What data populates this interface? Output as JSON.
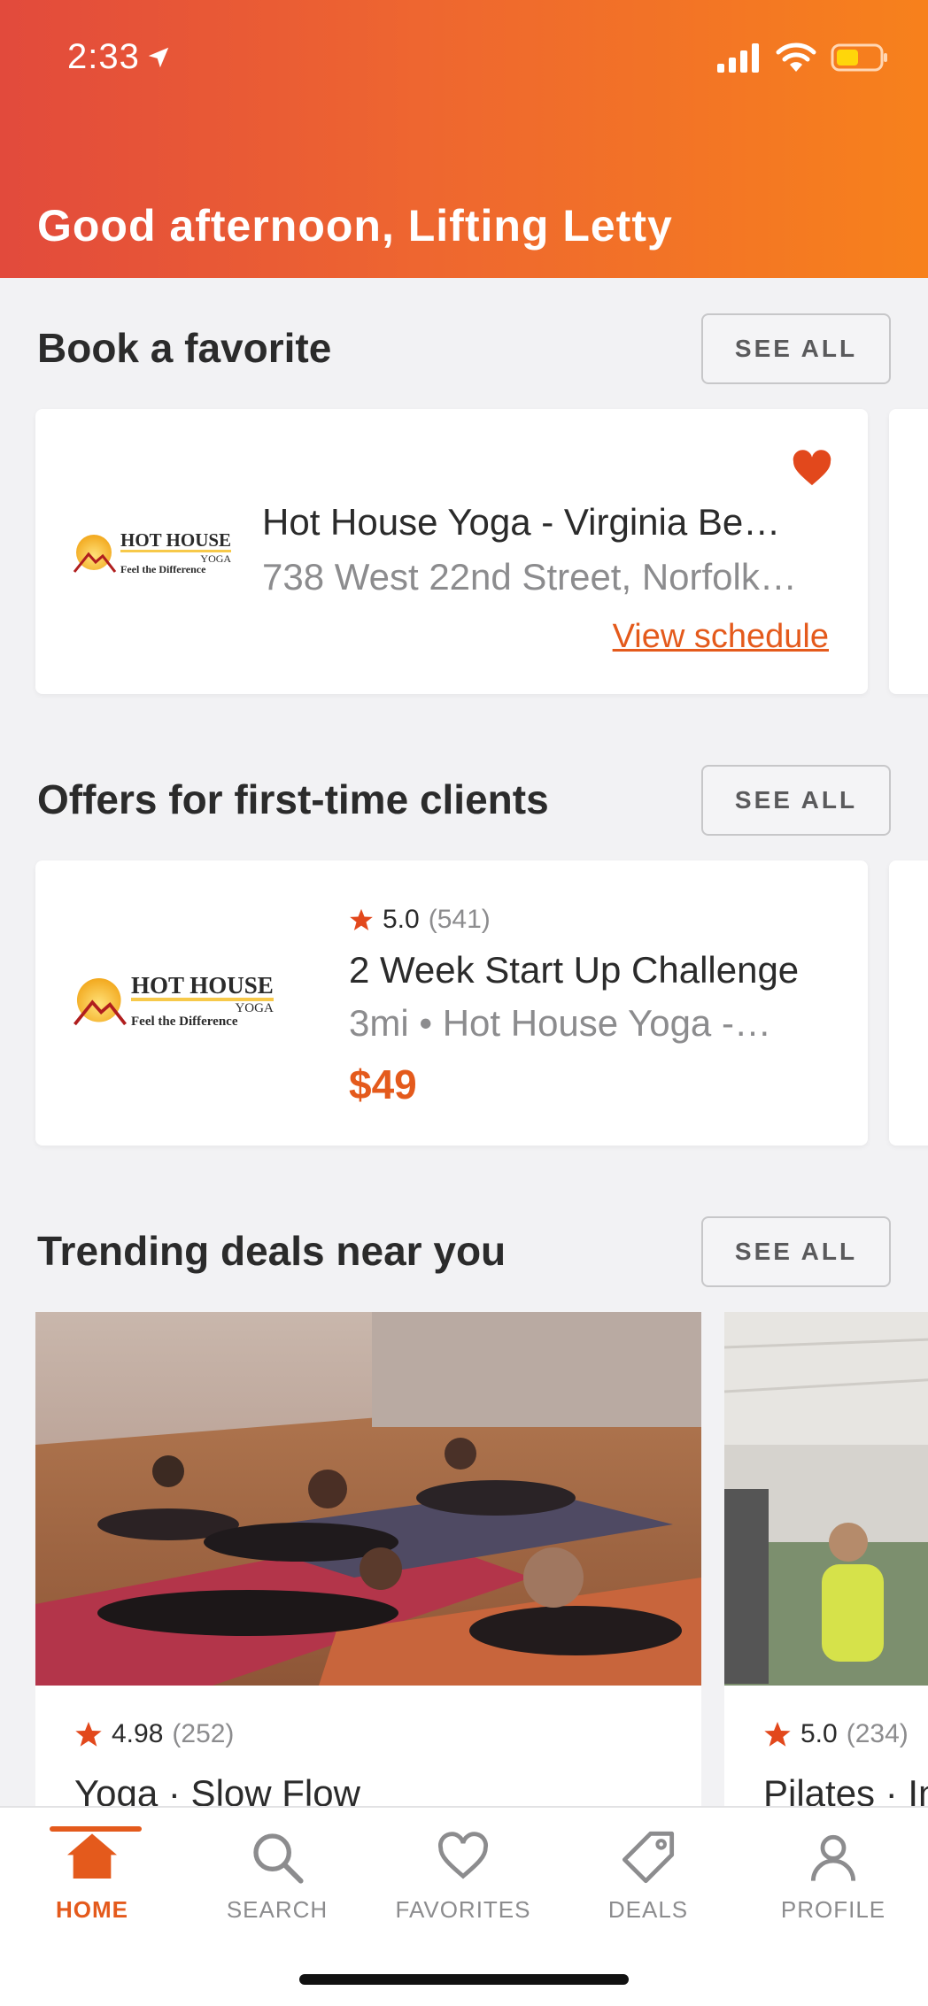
{
  "status_bar": {
    "time": "2:33"
  },
  "header": {
    "greeting": "Good afternoon, Lifting Letty"
  },
  "sections": {
    "favorites": {
      "title": "Book a favorite",
      "see_all": "SEE ALL"
    },
    "offers": {
      "title": "Offers for first-time clients",
      "see_all": "SEE ALL"
    },
    "trending": {
      "title": "Trending deals near you",
      "see_all": "SEE ALL"
    }
  },
  "favorite_card": {
    "logo": {
      "line1": "HOT HOUSE",
      "line2": "YOGA",
      "line3": "Feel the Difference"
    },
    "title": "Hot House Yoga - Virginia Be…",
    "address": "738 West 22nd Street, Norfolk…",
    "link": "View schedule"
  },
  "offer_card": {
    "logo": {
      "line1": "HOT HOUSE",
      "line2": "YOGA",
      "line3": "Feel the Difference"
    },
    "rating": "5.0",
    "reviews": "(541)",
    "title": "2 Week Start Up Challenge",
    "subtitle": "3mi • Hot House Yoga -…",
    "price": "$49"
  },
  "deals": [
    {
      "rating": "4.98",
      "reviews": "(252)",
      "title": "Yoga · Slow Flow"
    },
    {
      "rating": "5.0",
      "reviews": "(234)",
      "title": "Pilates · In"
    }
  ],
  "tabs": [
    {
      "label": "HOME",
      "icon": "home-icon",
      "active": true
    },
    {
      "label": "SEARCH",
      "icon": "search-icon",
      "active": false
    },
    {
      "label": "FAVORITES",
      "icon": "heart-icon",
      "active": false
    },
    {
      "label": "DEALS",
      "icon": "tag-icon",
      "active": false
    },
    {
      "label": "PROFILE",
      "icon": "person-icon",
      "active": false
    }
  ],
  "colors": {
    "accent": "#e45a1c",
    "header_start": "#e24a3c",
    "header_end": "#f7811c",
    "background": "#f2f2f4"
  }
}
